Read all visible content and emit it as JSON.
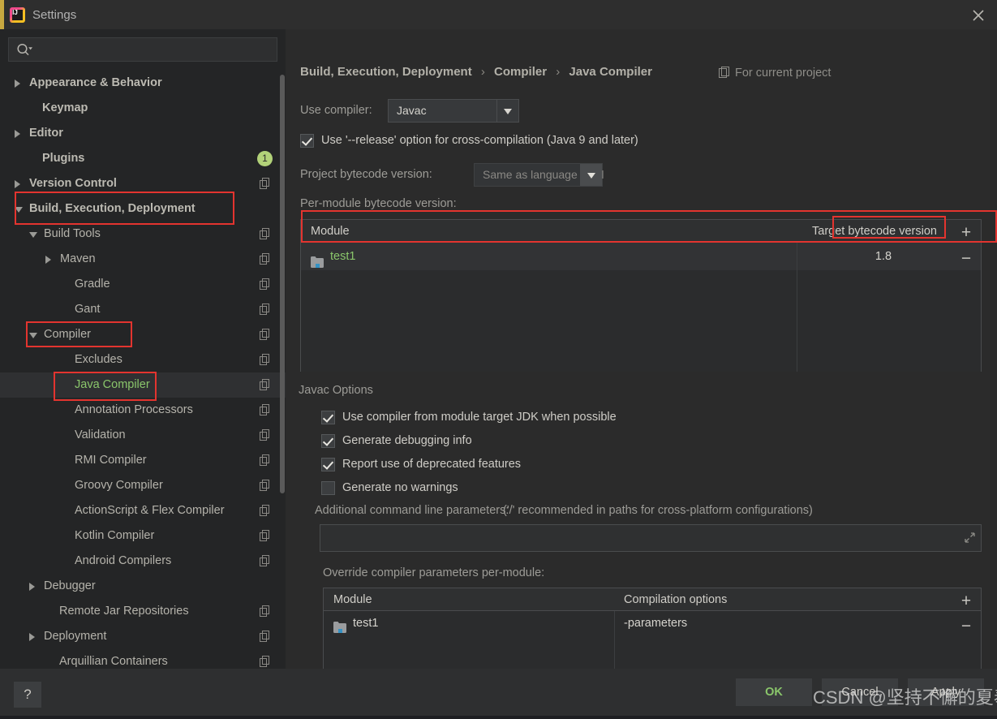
{
  "window": {
    "title": "Settings",
    "close_icon": "close-icon",
    "logo": "intellij-idea-logo"
  },
  "search": {
    "placeholder": "",
    "value": "",
    "icon": "search-icon"
  },
  "sidebar": {
    "items": [
      {
        "label": "Appearance & Behavior",
        "arrow": "right",
        "indent": 20,
        "bold": true,
        "copy": false,
        "badge": null,
        "selected": false
      },
      {
        "label": "Keymap",
        "arrow": "none",
        "indent": 36,
        "bold": true,
        "copy": false,
        "badge": null,
        "selected": false
      },
      {
        "label": "Editor",
        "arrow": "right",
        "indent": 20,
        "bold": true,
        "copy": false,
        "badge": null,
        "selected": false
      },
      {
        "label": "Plugins",
        "arrow": "none",
        "indent": 36,
        "bold": true,
        "copy": false,
        "badge": "1",
        "selected": false
      },
      {
        "label": "Version Control",
        "arrow": "right",
        "indent": 20,
        "bold": true,
        "copy": true,
        "badge": null,
        "selected": false
      },
      {
        "label": "Build, Execution, Deployment",
        "arrow": "down",
        "indent": 20,
        "bold": true,
        "copy": false,
        "badge": null,
        "selected": false
      },
      {
        "label": "Build Tools",
        "arrow": "down",
        "indent": 38,
        "bold": false,
        "copy": true,
        "badge": null,
        "selected": false
      },
      {
        "label": "Maven",
        "arrow": "right",
        "indent": 58,
        "bold": false,
        "copy": true,
        "badge": null,
        "selected": false
      },
      {
        "label": "Gradle",
        "arrow": "none",
        "indent": 76,
        "bold": false,
        "copy": true,
        "badge": null,
        "selected": false
      },
      {
        "label": "Gant",
        "arrow": "none",
        "indent": 76,
        "bold": false,
        "copy": true,
        "badge": null,
        "selected": false
      },
      {
        "label": "Compiler",
        "arrow": "down",
        "indent": 38,
        "bold": false,
        "copy": true,
        "badge": null,
        "selected": false
      },
      {
        "label": "Excludes",
        "arrow": "none",
        "indent": 76,
        "bold": false,
        "copy": true,
        "badge": null,
        "selected": false
      },
      {
        "label": "Java Compiler",
        "arrow": "none",
        "indent": 76,
        "bold": false,
        "copy": true,
        "badge": null,
        "selected": true
      },
      {
        "label": "Annotation Processors",
        "arrow": "none",
        "indent": 76,
        "bold": false,
        "copy": true,
        "badge": null,
        "selected": false
      },
      {
        "label": "Validation",
        "arrow": "none",
        "indent": 76,
        "bold": false,
        "copy": true,
        "badge": null,
        "selected": false
      },
      {
        "label": "RMI Compiler",
        "arrow": "none",
        "indent": 76,
        "bold": false,
        "copy": true,
        "badge": null,
        "selected": false
      },
      {
        "label": "Groovy Compiler",
        "arrow": "none",
        "indent": 76,
        "bold": false,
        "copy": true,
        "badge": null,
        "selected": false
      },
      {
        "label": "ActionScript & Flex Compiler",
        "arrow": "none",
        "indent": 76,
        "bold": false,
        "copy": true,
        "badge": null,
        "selected": false
      },
      {
        "label": "Kotlin Compiler",
        "arrow": "none",
        "indent": 76,
        "bold": false,
        "copy": true,
        "badge": null,
        "selected": false
      },
      {
        "label": "Android Compilers",
        "arrow": "none",
        "indent": 76,
        "bold": false,
        "copy": true,
        "badge": null,
        "selected": false
      },
      {
        "label": "Debugger",
        "arrow": "right",
        "indent": 38,
        "bold": false,
        "copy": false,
        "badge": null,
        "selected": false
      },
      {
        "label": "Remote Jar Repositories",
        "arrow": "none",
        "indent": 57,
        "bold": false,
        "copy": true,
        "badge": null,
        "selected": false
      },
      {
        "label": "Deployment",
        "arrow": "right",
        "indent": 38,
        "bold": false,
        "copy": true,
        "badge": null,
        "selected": false
      },
      {
        "label": "Arquillian Containers",
        "arrow": "none",
        "indent": 57,
        "bold": false,
        "copy": true,
        "badge": null,
        "selected": false
      }
    ]
  },
  "main": {
    "breadcrumb": {
      "part1": "Build, Execution, Deployment",
      "part2": "Compiler",
      "part3": "Java Compiler",
      "separator": "›"
    },
    "for_current_project": "For current project",
    "use_compiler_label": "Use compiler:",
    "use_compiler_value": "Javac",
    "release_option_label": "Use '--release' option for cross-compilation (Java 9 and later)",
    "release_option_checked": true,
    "project_bytecode_label": "Project bytecode version:",
    "project_bytecode_value": "Same as language level",
    "per_module_label": "Per-module bytecode version:",
    "bytecode_table": {
      "columns": [
        "Module",
        "Target bytecode version"
      ],
      "rows": [
        {
          "module": "test1",
          "target": "1.8"
        }
      ],
      "add_label": "+",
      "remove_label": "−"
    },
    "javac_options_title": "Javac Options",
    "javac_options": [
      {
        "label": "Use compiler from module target JDK when possible",
        "checked": true
      },
      {
        "label": "Generate debugging info",
        "checked": true
      },
      {
        "label": "Report use of deprecated features",
        "checked": true
      },
      {
        "label": "Generate no warnings",
        "checked": false
      }
    ],
    "additional_params_label": "Additional command line parameters:",
    "additional_params_hint": "('/' recommended in paths for cross-platform configurations)",
    "additional_params_value": "",
    "override_label": "Override compiler parameters per-module:",
    "override_table": {
      "columns": [
        "Module",
        "Compilation options"
      ],
      "rows": [
        {
          "module": "test1",
          "options": "-parameters"
        }
      ],
      "add_label": "+",
      "remove_label": "−"
    }
  },
  "footer": {
    "help_label": "?",
    "ok_label": "OK",
    "cancel_label": "Cancel",
    "apply_label": "Apply"
  },
  "watermark": "CSDN @坚持不懈的夏奉",
  "colors": {
    "accent_green": "#8ac66b",
    "annotation_red": "#e3342f",
    "panel_bg": "#2b2b2b",
    "sidebar_bg": "#242526",
    "badge_green": "#b2d279"
  }
}
